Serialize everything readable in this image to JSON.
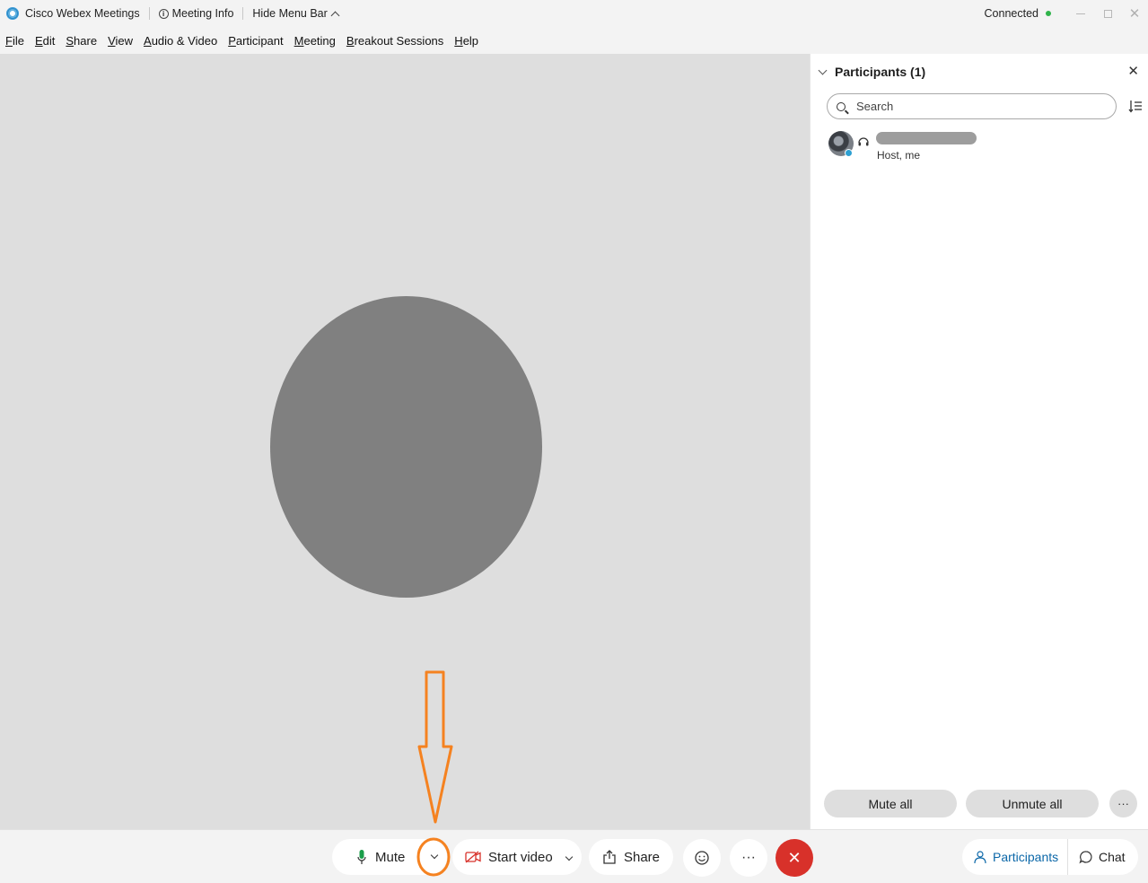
{
  "titlebar": {
    "app_name": "Cisco Webex Meetings",
    "meeting_info": "Meeting Info",
    "hide_menu_bar": "Hide Menu Bar",
    "status": "Connected"
  },
  "menu": [
    {
      "ul": "F",
      "rest": "ile"
    },
    {
      "ul": "E",
      "rest": "dit"
    },
    {
      "ul": "S",
      "rest": "hare"
    },
    {
      "ul": "V",
      "rest": "iew"
    },
    {
      "ul": "A",
      "rest": "udio & Video"
    },
    {
      "ul": "P",
      "rest": "articipant"
    },
    {
      "ul": "M",
      "rest": "eeting"
    },
    {
      "ul": "B",
      "rest": "reakout Sessions"
    },
    {
      "ul": "H",
      "rest": "elp"
    }
  ],
  "participants_panel": {
    "title": "Participants (1)",
    "search_placeholder": "Search",
    "participant": {
      "role": "Host, me"
    },
    "mute_all": "Mute all",
    "unmute_all": "Unmute all"
  },
  "controls": {
    "mute": "Mute",
    "start_video": "Start video",
    "share": "Share",
    "participants_tab": "Participants",
    "chat_tab": "Chat"
  },
  "icons": {
    "mic": "microphone-icon",
    "camera": "video-off-icon",
    "share": "share-icon",
    "reactions": "smiley-icon",
    "more": "more-options-icon",
    "end": "close-icon"
  },
  "colors": {
    "end_button": "#d8312a",
    "mic_green": "#1a9e4a",
    "camera_red": "#d8312a",
    "active_tab": "#0b67a8",
    "annotation": "#f58220",
    "connected_dot": "#2fb34a"
  }
}
